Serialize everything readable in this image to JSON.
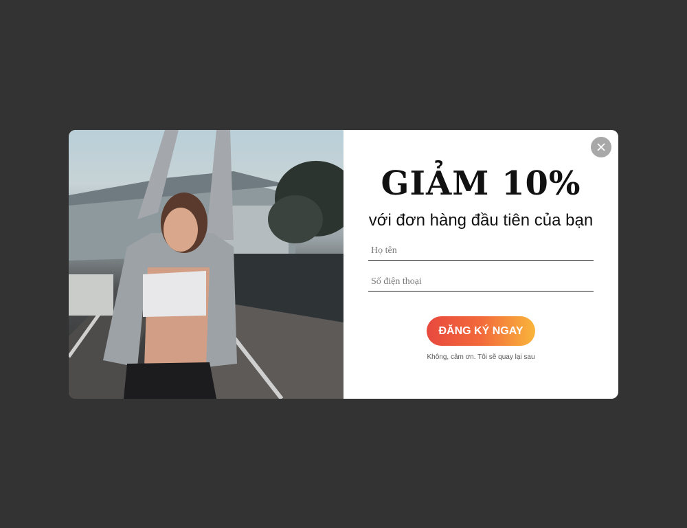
{
  "popup": {
    "headline": "GIẢM 10%",
    "subheadline": "với đơn hàng đầu tiên của bạn",
    "name_placeholder": "Họ tên",
    "phone_placeholder": "Số điện thoại",
    "submit_label": "ĐĂNG KÝ NGAY",
    "dismiss_label": "Không, cảm ơn. Tôi sẽ quay lại sau",
    "close_icon": "close-icon",
    "image_icon": "promo-photo"
  },
  "colors": {
    "overlay": "#333333",
    "button_gradient_start": "#e8493e",
    "button_gradient_end": "#f9b53b",
    "close_button": "#a8a8a8"
  }
}
